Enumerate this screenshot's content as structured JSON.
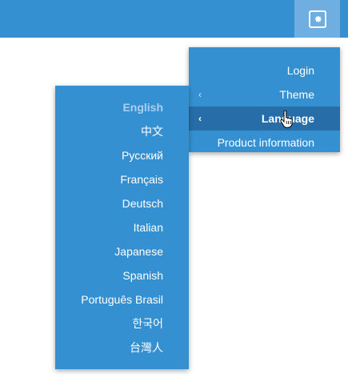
{
  "topbar": {
    "accent_color": "#3590d2",
    "settings_icon": "gear-icon"
  },
  "main_menu": {
    "items": [
      {
        "label": "Login",
        "has_submenu": false
      },
      {
        "label": "Theme",
        "has_submenu": true
      },
      {
        "label": "Language",
        "has_submenu": true,
        "active": true
      },
      {
        "label": "Product information",
        "has_submenu": false
      }
    ],
    "submenu_icon": "chevron-left-icon"
  },
  "language_menu": {
    "items": [
      {
        "label": "English",
        "current": true
      },
      {
        "label": "中文"
      },
      {
        "label": "Русский"
      },
      {
        "label": "Français"
      },
      {
        "label": "Deutsch"
      },
      {
        "label": "Italian"
      },
      {
        "label": "Japanese"
      },
      {
        "label": "Spanish"
      },
      {
        "label": "Português Brasil"
      },
      {
        "label": "한국어"
      },
      {
        "label": "台灣人"
      }
    ]
  },
  "pointer": {
    "icon": "hand-pointer-icon"
  }
}
